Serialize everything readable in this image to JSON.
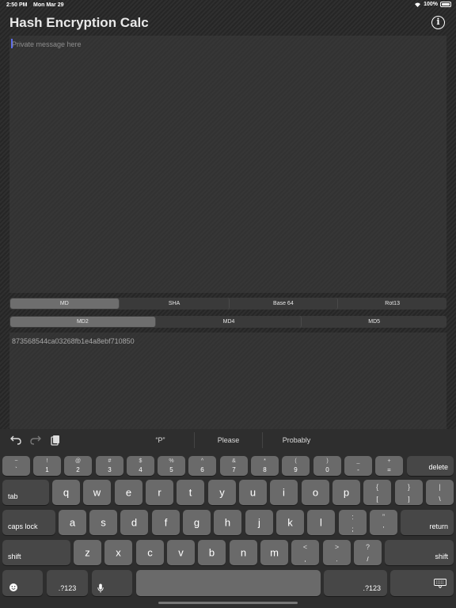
{
  "status": {
    "time": "2:50 PM",
    "date": "Mon Mar 29",
    "battery": "100%"
  },
  "app": {
    "title": "Hash Encryption Calc",
    "info_icon": "info-icon"
  },
  "input": {
    "placeholder": "Private message here",
    "value": ""
  },
  "segments_primary": {
    "items": [
      "MD",
      "SHA",
      "Base 64",
      "Rot13"
    ],
    "selected": "MD"
  },
  "segments_secondary": {
    "items": [
      "MD2",
      "MD4",
      "MD5"
    ],
    "selected": "MD2"
  },
  "output": {
    "value": "873568544ca03268fb1e4a8ebf710850"
  },
  "keyboard": {
    "suggestions": [
      "“P”",
      "Please",
      "Probably"
    ],
    "icons": [
      "undo-icon",
      "redo-icon",
      "clipboard-icon",
      "emoji-icon",
      "mic-icon",
      "keyboard-dismiss-icon"
    ],
    "row1": [
      {
        "up": "~",
        "dn": "`"
      },
      {
        "up": "!",
        "dn": "1"
      },
      {
        "up": "@",
        "dn": "2"
      },
      {
        "up": "#",
        "dn": "3"
      },
      {
        "up": "$",
        "dn": "4"
      },
      {
        "up": "%",
        "dn": "5"
      },
      {
        "up": "^",
        "dn": "6"
      },
      {
        "up": "&",
        "dn": "7"
      },
      {
        "up": "*",
        "dn": "8"
      },
      {
        "up": "(",
        "dn": "9"
      },
      {
        "up": ")",
        "dn": "0"
      },
      {
        "up": "_",
        "dn": "-"
      },
      {
        "up": "+",
        "dn": "="
      }
    ],
    "delete": "delete",
    "tab": "tab",
    "row2": [
      "q",
      "w",
      "e",
      "r",
      "t",
      "y",
      "u",
      "i",
      "o",
      "p"
    ],
    "row2_sym": [
      {
        "up": "{",
        "dn": "["
      },
      {
        "up": "}",
        "dn": "]"
      },
      {
        "up": "|",
        "dn": "\\"
      }
    ],
    "caps": "caps lock",
    "row3": [
      "a",
      "s",
      "d",
      "f",
      "g",
      "h",
      "j",
      "k",
      "l"
    ],
    "row3_sym": [
      {
        "up": ":",
        "dn": ";"
      },
      {
        "up": "”",
        "dn": "’"
      }
    ],
    "return": "return",
    "shift": "shift",
    "row4": [
      "z",
      "x",
      "c",
      "v",
      "b",
      "n",
      "m"
    ],
    "row4_sym": [
      {
        "up": "<",
        "dn": ","
      },
      {
        "up": ">",
        "dn": "."
      },
      {
        "up": "?",
        "dn": "/"
      }
    ],
    "numbers": ".?123"
  }
}
